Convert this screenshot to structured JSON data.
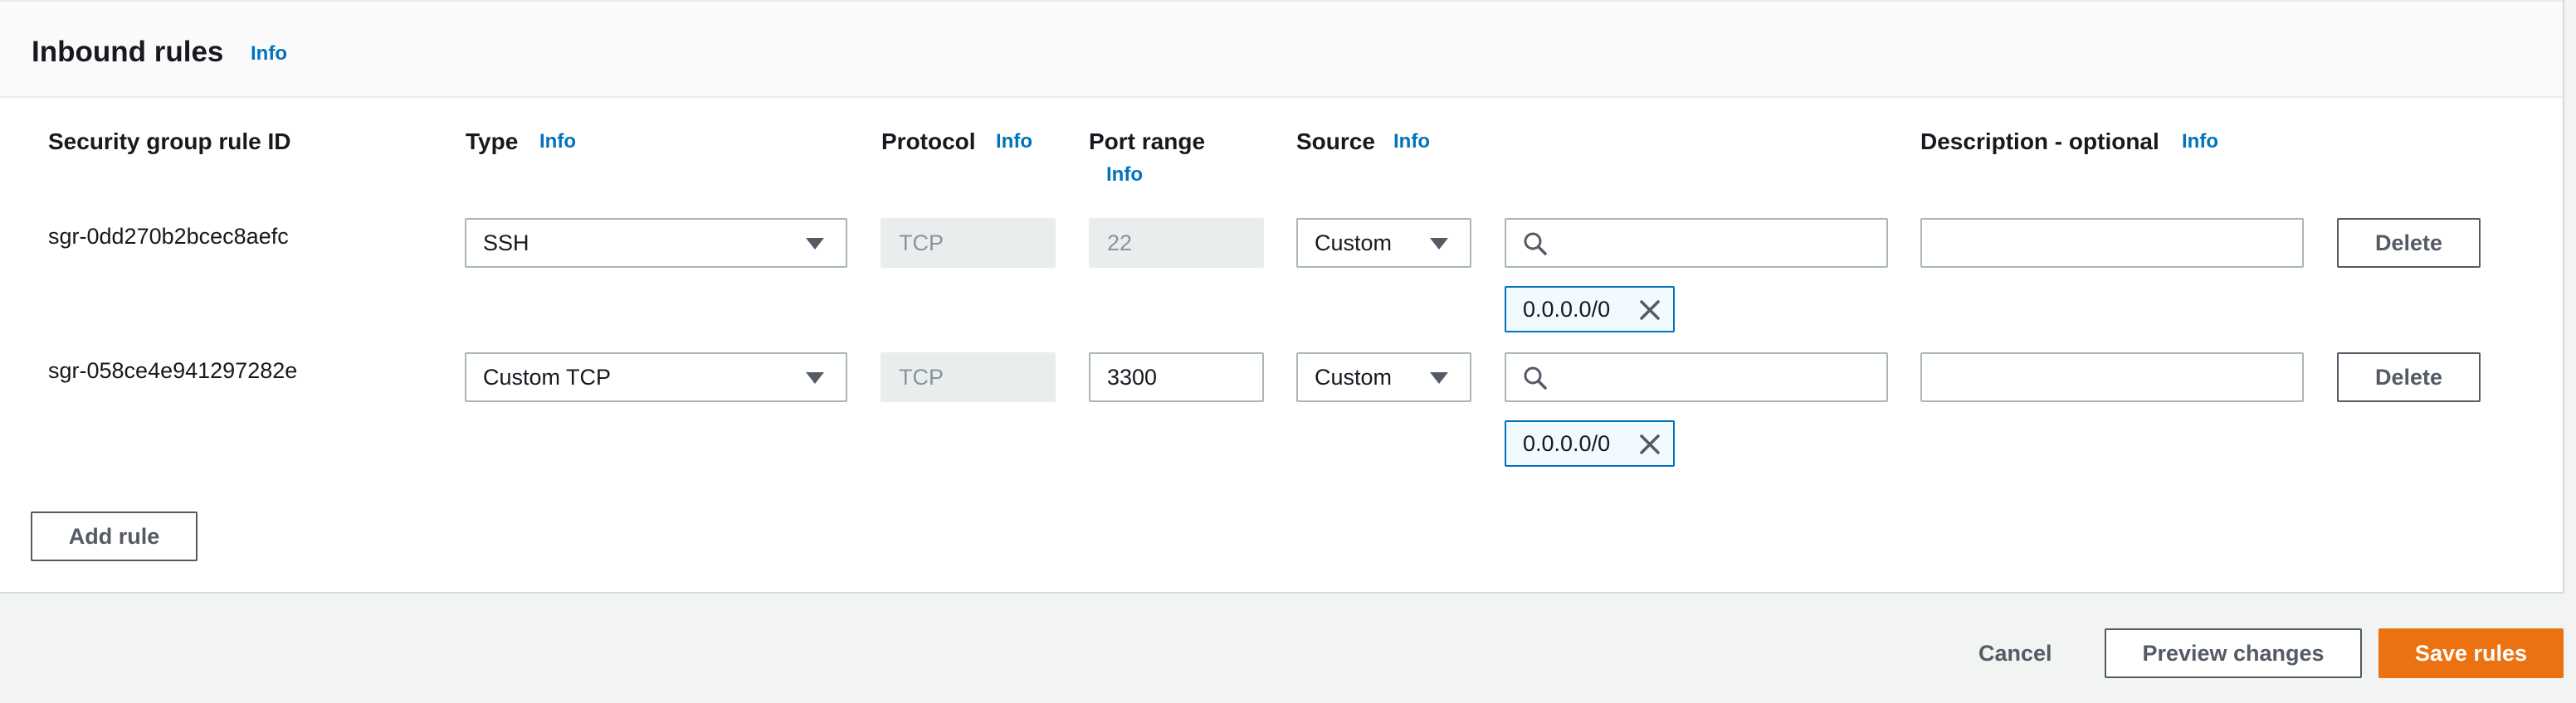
{
  "panel": {
    "title": "Inbound rules",
    "title_info": "Info"
  },
  "columns": {
    "rule_id": "Security group rule ID",
    "type": "Type",
    "type_info": "Info",
    "protocol": "Protocol",
    "protocol_info": "Info",
    "port_range": "Port range",
    "port_range_info": "Info",
    "source": "Source",
    "source_info": "Info",
    "description": "Description - optional",
    "description_info": "Info"
  },
  "rules": [
    {
      "id": "sgr-0dd270b2bcec8aefc",
      "type": "SSH",
      "protocol": "TCP",
      "port_range": "22",
      "source_type": "Custom",
      "search_value": "",
      "cidr_token": "0.0.0.0/0",
      "description": "",
      "delete_label": "Delete"
    },
    {
      "id": "sgr-058ce4e941297282e",
      "type": "Custom TCP",
      "protocol": "TCP",
      "port_range": "3300",
      "source_type": "Custom",
      "search_value": "",
      "cidr_token": "0.0.0.0/0",
      "description": "",
      "delete_label": "Delete"
    }
  ],
  "add_rule_label": "Add rule",
  "footer": {
    "cancel_label": "Cancel",
    "preview_label": "Preview changes",
    "save_label": "Save rules"
  },
  "colors": {
    "accent": "#ec7211",
    "link": "#0073bb",
    "token_border": "#0073bb"
  },
  "icons": {
    "select_caret": "caret-down-icon",
    "search": "search-icon",
    "token_remove": "close-icon"
  }
}
